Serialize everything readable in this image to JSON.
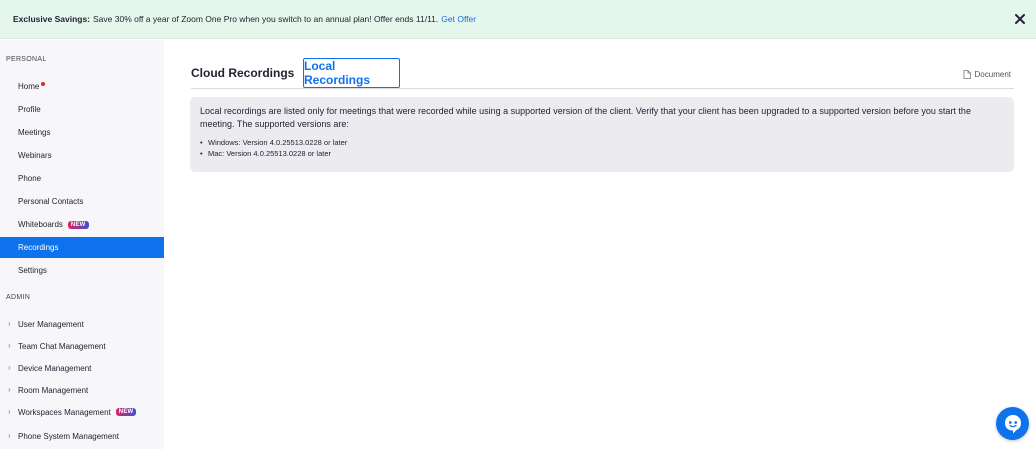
{
  "banner": {
    "strong": "Exclusive Savings:",
    "text": "Save 30% off a year of Zoom One Pro when you switch to an annual plan! Offer ends 11/11.",
    "link": "Get Offer"
  },
  "sidebar": {
    "personal_title": "PERSONAL",
    "personal_items": [
      {
        "label": "Home"
      },
      {
        "label": "Profile"
      },
      {
        "label": "Meetings"
      },
      {
        "label": "Webinars"
      },
      {
        "label": "Phone"
      },
      {
        "label": "Personal Contacts"
      },
      {
        "label": "Whiteboards",
        "badge": "NEW"
      },
      {
        "label": "Recordings",
        "active": true
      },
      {
        "label": "Settings"
      }
    ],
    "admin_title": "ADMIN",
    "admin_items": [
      {
        "label": "User Management"
      },
      {
        "label": "Team Chat Management"
      },
      {
        "label": "Device Management"
      },
      {
        "label": "Room Management"
      },
      {
        "label": "Workspaces Management",
        "badge": "NEW"
      },
      {
        "label": "Phone System Management"
      }
    ]
  },
  "tabs": {
    "cloud": "Cloud Recordings",
    "local": "Local Recordings",
    "active": "local"
  },
  "document_link": "Document",
  "info": {
    "text": "Local recordings are listed only for meetings that were recorded while using a supported version of the client. Verify that your client has been upgraded to a supported version before you start the meeting. The supported versions are:",
    "versions": [
      "Windows: Version 4.0.25513.0228 or later",
      "Mac: Version 4.0.25513.0228 or later"
    ]
  },
  "colors": {
    "accent": "#0e72ed",
    "banner_bg": "#e5f6ec",
    "sidebar_bg": "#f7f7f9",
    "info_bg": "#ececf0"
  }
}
